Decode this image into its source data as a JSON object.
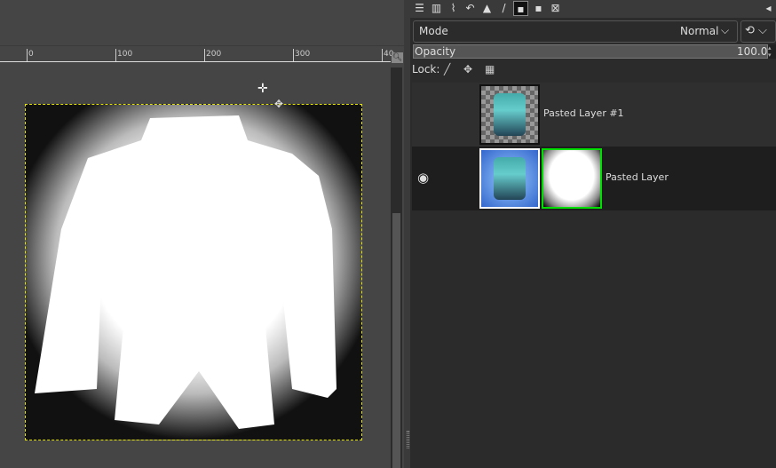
{
  "canvas": {
    "ruler_labels": [
      "0",
      "100",
      "200",
      "300",
      "40"
    ]
  },
  "panel": {
    "tab_icons": [
      "layers-icon",
      "channels-icon",
      "paths-icon",
      "undo-history-icon",
      "histogram-icon",
      "brushes-icon",
      "patterns-icon",
      "fonts-icon",
      "images-icon"
    ],
    "mode_label": "Mode",
    "mode_value": "Normal",
    "opacity_label": "Opacity",
    "opacity_value": "100.0",
    "lock_label": "Lock:",
    "layers": [
      {
        "name": "Pasted Layer #1",
        "visible": false,
        "has_mask": false
      },
      {
        "name": "Pasted Layer",
        "visible": true,
        "has_mask": true,
        "selected": true,
        "mask_active": true
      }
    ]
  },
  "colors": {
    "selection_border": "#e6e600",
    "mask_border": "#00dd00",
    "layer_border": "#ffffff"
  }
}
